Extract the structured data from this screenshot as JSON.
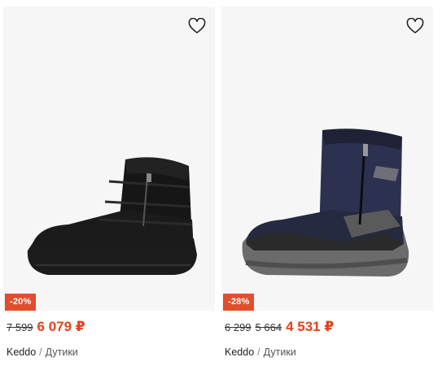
{
  "products": [
    {
      "discount": "-20%",
      "old_prices": [
        "7 599"
      ],
      "price": "6 079 ₽",
      "brand": "Keddo",
      "separator": "/",
      "category": "Дутики",
      "favorite_icon": "heart-outline-icon",
      "image": "black-winter-boot",
      "accent_color": "#e0421b"
    },
    {
      "discount": "-28%",
      "old_prices": [
        "6 299",
        "5 664"
      ],
      "price": "4 531 ₽",
      "brand": "Keddo",
      "separator": "/",
      "category": "Дутики",
      "favorite_icon": "heart-outline-icon",
      "image": "navy-winter-boot",
      "accent_color": "#e0421b"
    }
  ]
}
